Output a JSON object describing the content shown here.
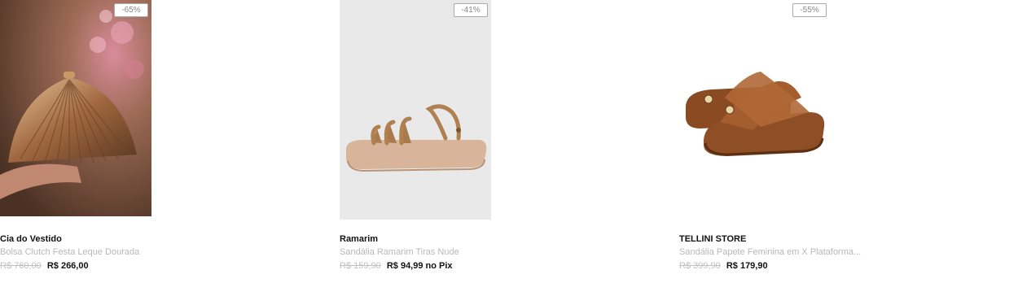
{
  "products": [
    {
      "discount": "-65%",
      "brand": "Cia do Vestido",
      "title": "Bolsa Clutch Festa Leque Dourada",
      "old_price": "R$ 760,00",
      "price": "R$ 266,00",
      "image": "clutch-bag-image"
    },
    {
      "discount": "-41%",
      "brand": "Ramarim",
      "title": "Sandália Ramarim Tiras Nude",
      "old_price": "R$ 159,90",
      "price": "R$ 94,99 no Pix",
      "image": "sandal-image"
    },
    {
      "discount": "-55%",
      "brand": "TELLINI STORE",
      "title": "Sandália Papete Feminina em X Plataforma...",
      "old_price": "R$ 399,90",
      "price": "R$ 179,90",
      "image": "platform-sandal-image"
    }
  ],
  "colors": {
    "badge_border": "#aaaaaa",
    "muted_text": "#b8b8b8",
    "price_text": "#111111"
  }
}
